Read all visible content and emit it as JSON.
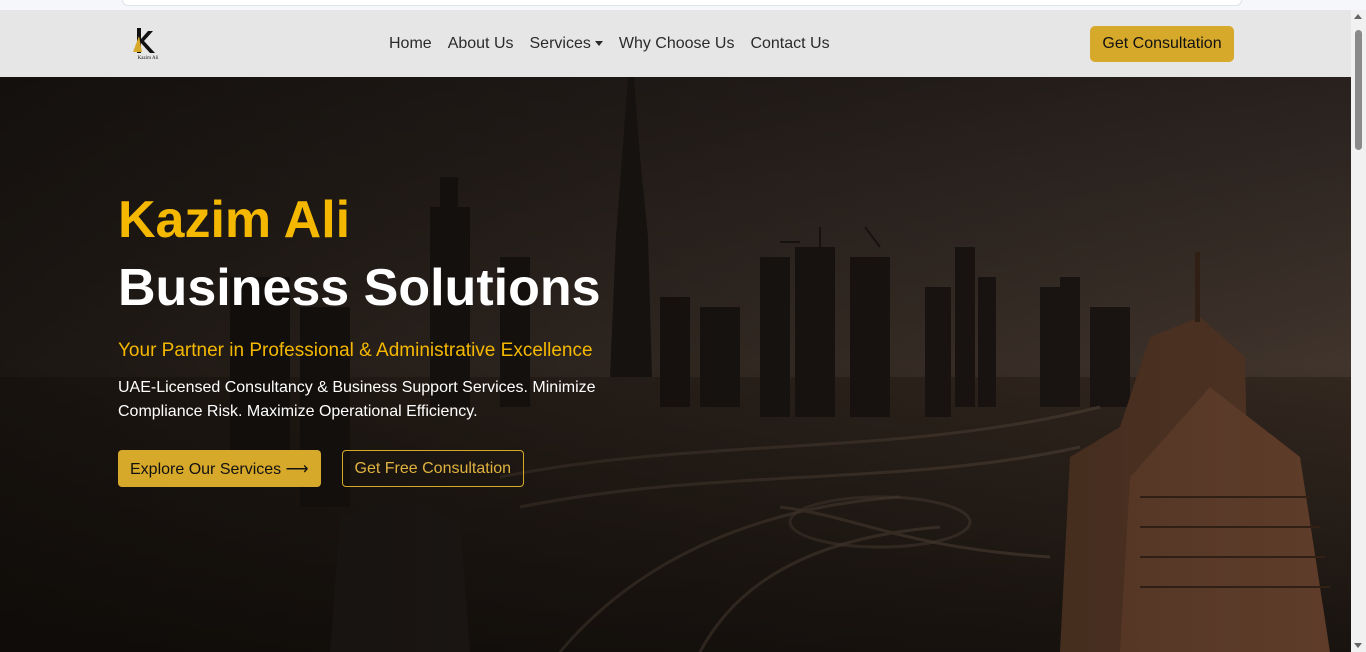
{
  "brand": {
    "logo_letter": "k",
    "logo_caption": "Kazim Ali"
  },
  "nav": {
    "items": [
      {
        "label": "Home"
      },
      {
        "label": "About Us"
      },
      {
        "label": "Services",
        "has_dropdown": true
      },
      {
        "label": "Why Choose Us"
      },
      {
        "label": "Contact Us"
      }
    ],
    "cta_label": "Get Consultation"
  },
  "hero": {
    "title_line1": "Kazim Ali",
    "title_line2": "Business Solutions",
    "subtitle": "Your Partner in Professional & Administrative Excellence",
    "description": "UAE-Licensed Consultancy & Business Support Services. Minimize Compliance Risk. Maximize Operational Efficiency.",
    "primary_button": "Explore Our Services ⟶",
    "secondary_button": "Get Free Consultation"
  },
  "colors": {
    "accent": "#d7a92b",
    "accent_text": "#f5b800",
    "navbar_bg": "#e6e6e6"
  }
}
